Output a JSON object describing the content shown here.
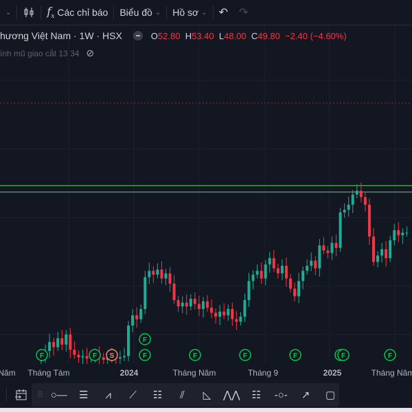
{
  "toolbar": {
    "indicators_label": "Các chỉ báo",
    "chart_label": "Biểu đồ",
    "profile_label": "Hồ sơ"
  },
  "legend": {
    "title": "hương Việt Nam · 1W · HSX",
    "o_label": "O",
    "o": "52.80",
    "h_label": "H",
    "h": "53.40",
    "l_label": "L",
    "l": "48.00",
    "c_label": "C",
    "c": "49.80",
    "change": "−2.40 (−4.60%)",
    "indicator": "ình mũ giao cắt 13 34"
  },
  "colors": {
    "up": "#22ab94",
    "down": "#f23645",
    "hline": "#4caf50",
    "marker": "#00c853",
    "split": "#ff8a65"
  },
  "axis": {
    "labels": [
      "Năm",
      "Tháng Tám",
      "2024",
      "Tháng Năm",
      "Tháng 9",
      "2025",
      "Tháng Năm"
    ]
  },
  "markers": {
    "f": "F",
    "s": "S"
  },
  "tools": [
    "calendar-range",
    "line-tool",
    "parallel-lines",
    "path",
    "trend-line",
    "fib-retracement",
    "parallel-channel",
    "triangle",
    "pattern",
    "fib-extension",
    "horizontal-ray",
    "arrow",
    "shape"
  ],
  "chart_data": {
    "type": "candlestick",
    "ylabel": "",
    "closes": [
      40.0,
      40.5,
      41.2,
      40.8,
      41.5,
      41.0,
      41.8,
      40.6,
      40.2,
      40.0,
      40.1,
      39.9,
      40.0,
      40.2,
      40.0,
      39.8,
      40.0,
      40.1,
      39.9,
      40.0,
      40.1,
      42.5,
      43.3,
      43.0,
      43.8,
      46.3,
      46.8,
      46.5,
      46.9,
      46.2,
      46.6,
      45.8,
      44.5,
      44.0,
      44.3,
      44.0,
      44.6,
      44.2,
      43.8,
      44.4,
      43.9,
      43.5,
      43.2,
      43.6,
      43.3,
      43.8,
      43.0,
      42.8,
      43.2,
      44.5,
      46.0,
      46.5,
      46.8,
      46.2,
      47.3,
      47.8,
      47.0,
      46.6,
      47.2,
      46.2,
      45.4,
      44.8,
      46.0,
      46.8,
      47.2,
      47.6,
      47.0,
      48.8,
      48.4,
      48.2,
      49.0,
      48.6,
      51.4,
      51.6,
      52.0,
      52.8,
      53.1,
      52.6,
      52.0,
      49.5,
      47.5,
      48.0,
      48.5,
      47.8,
      49.2,
      50.0,
      49.6,
      49.8,
      49.8
    ],
    "hlines": [
      53.5,
      53.0
    ],
    "alert_line": 60.0
  }
}
